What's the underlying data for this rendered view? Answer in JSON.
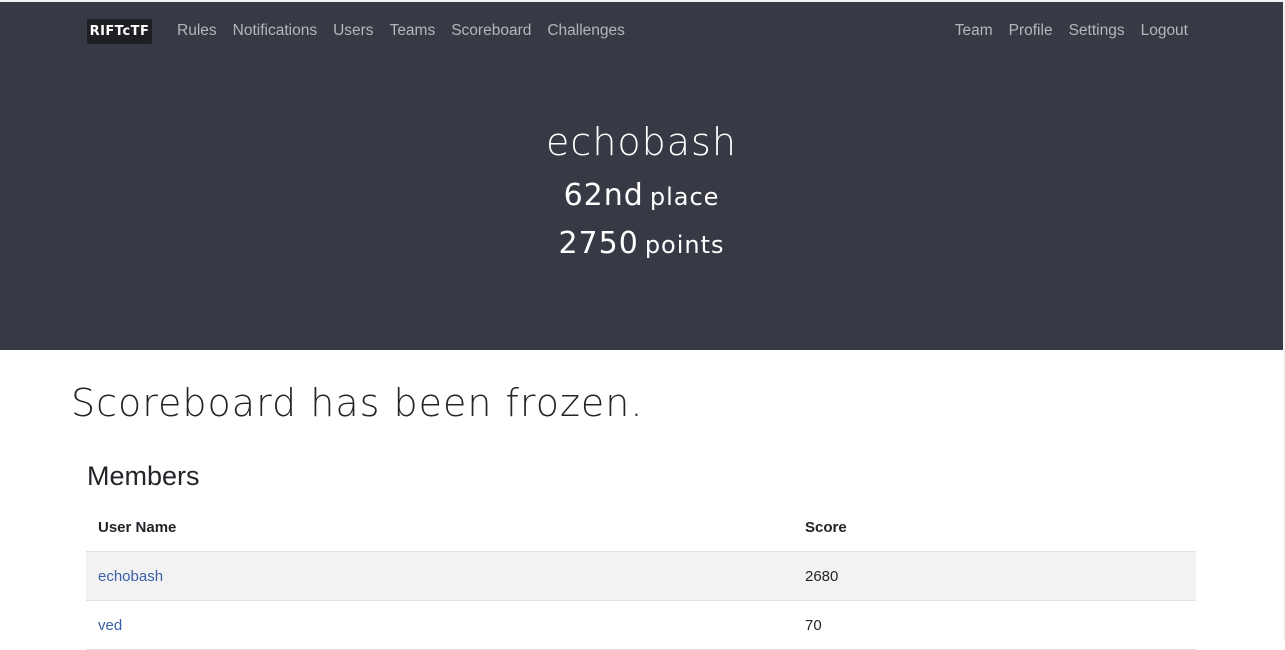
{
  "navbar": {
    "brand": "RIFTcTF",
    "left_links": [
      "Rules",
      "Notifications",
      "Users",
      "Teams",
      "Scoreboard",
      "Challenges"
    ],
    "right_links": [
      "Team",
      "Profile",
      "Settings",
      "Logout"
    ]
  },
  "header": {
    "username": "echobash",
    "place_number": "62nd",
    "place_label": "place",
    "points_number": "2750",
    "points_label": "points"
  },
  "main": {
    "frozen_message": "Scoreboard has been frozen.",
    "members_heading": "Members",
    "table": {
      "columns": [
        "User Name",
        "Score"
      ],
      "rows": [
        {
          "user": "echobash",
          "score": "2680"
        },
        {
          "user": "ved",
          "score": "70"
        }
      ]
    }
  },
  "colors": {
    "header_bg": "#373a44",
    "link": "#3a5ea8",
    "nav_text": "#b4b6ba"
  }
}
